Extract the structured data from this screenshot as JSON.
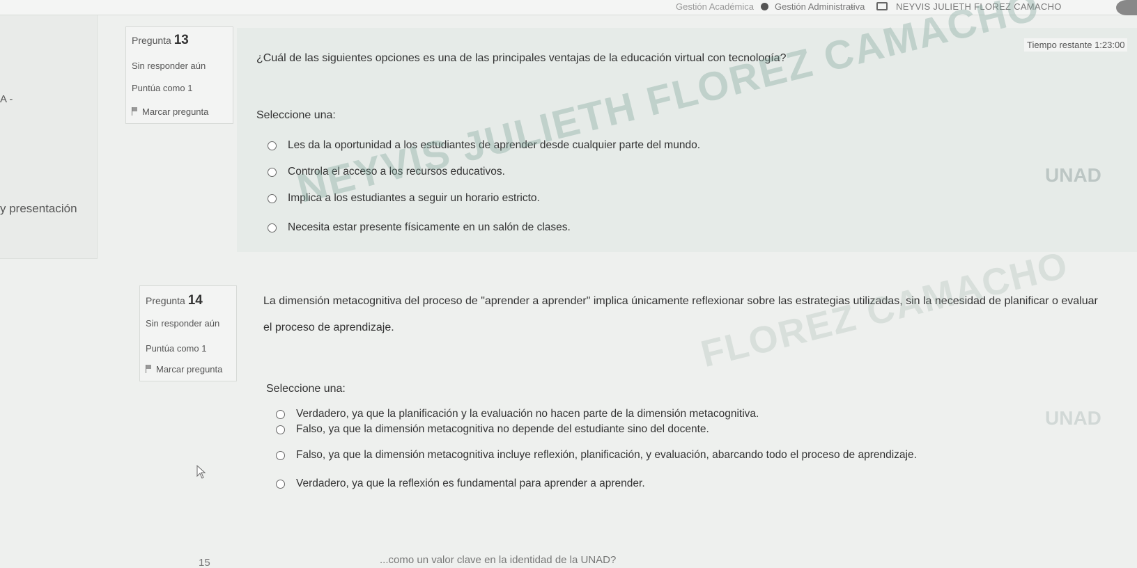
{
  "topbar": {
    "nav_academic": "Gestión Académica",
    "nav_admin": "Gestión Administrativa",
    "chevron": "⌄",
    "user_name": "NEYVIS JULIETH FLOREZ CAMACHO"
  },
  "left": {
    "letter": "A -",
    "presentacion": "y presentación",
    "page_num": "15"
  },
  "timer": {
    "label": "Tiempo restante",
    "value": "1:23:00"
  },
  "questions": [
    {
      "label": "Pregunta",
      "number": "13",
      "status": "Sin responder aún",
      "points": "Puntúa como 1",
      "flag": "Marcar pregunta",
      "text": "¿Cuál de las siguientes opciones es una de las principales ventajas de la educación virtual con tecnología?",
      "select_label": "Seleccione una:",
      "options": [
        "Les da la oportunidad a los estudiantes de aprender desde cualquier parte del mundo.",
        "Controla el acceso a los recursos educativos.",
        "Implica a los estudiantes a seguir un horario estricto.",
        "Necesita estar presente físicamente en un salón de clases."
      ]
    },
    {
      "label": "Pregunta",
      "number": "14",
      "status": "Sin responder aún",
      "points": "Puntúa como 1",
      "flag": "Marcar pregunta",
      "text_line1": "La dimensión metacognitiva del proceso de \"aprender a aprender\" implica únicamente reflexionar sobre las estrategias utilizadas, sin la necesidad de planificar o evaluar",
      "text_line2": "el proceso de aprendizaje.",
      "select_label": "Seleccione una:",
      "options": [
        "Verdadero, ya que la planificación y la evaluación no hacen parte de la dimensión metacognitiva.",
        "Falso, ya que la dimensión metacognitiva no depende del estudiante sino del docente.",
        "Falso, ya que la dimensión metacognitiva incluye reflexión, planificación, y evaluación, abarcando todo el proceso de aprendizaje.",
        "Verdadero, ya que la reflexión es fundamental para aprender a aprender."
      ]
    }
  ],
  "watermark": {
    "line_a": "NEYVIS JULIETH FLOREZ CAMACHO",
    "line_b": "FLOREZ CAMACHO",
    "logo": "UNAD"
  },
  "bottom": {
    "partial": "...como un valor clave en la identidad de la UNAD?"
  }
}
